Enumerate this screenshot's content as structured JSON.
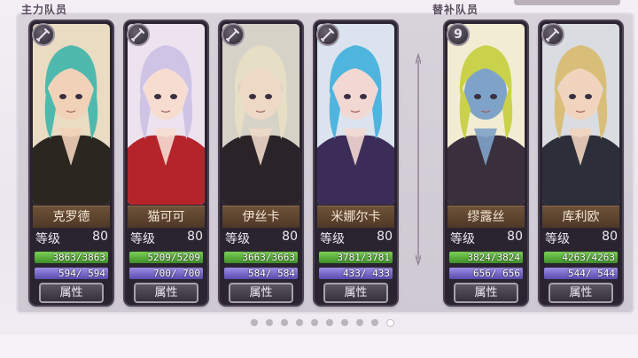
{
  "sections": {
    "main_label": "主力队员",
    "reserve_label": "替补队员"
  },
  "level_label": "等级",
  "attr_label": "属性",
  "cards": [
    {
      "name": "克罗德",
      "level": "80",
      "hp": "3863/3863",
      "mp": "594/ 594",
      "badge": "",
      "hair": "#4fb9ad",
      "skin": "#f1d2b8",
      "bg": "#e9dcc3",
      "outfit": "#2b2620"
    },
    {
      "name": "猫可可",
      "level": "80",
      "hp": "5209/5209",
      "mp": "700/ 700",
      "badge": "",
      "hair": "#cfc4e6",
      "skin": "#f6ddd0",
      "bg": "#ede3ee",
      "outfit": "#b5242b"
    },
    {
      "name": "伊丝卡",
      "level": "80",
      "hp": "3663/3663",
      "mp": "584/ 584",
      "badge": "",
      "hair": "#e7dec6",
      "skin": "#eed8c6",
      "bg": "#d6d2c8",
      "outfit": "#2a2428"
    },
    {
      "name": "米娜尔卡",
      "level": "80",
      "hp": "3781/3781",
      "mp": "433/ 433",
      "badge": "",
      "hair": "#4fb5de",
      "skin": "#f2d8d2",
      "bg": "#dbe4ee",
      "outfit": "#3c2c58"
    },
    {
      "name": "缪露丝",
      "level": "80",
      "hp": "3824/3824",
      "mp": "656/ 656",
      "badge": "9",
      "hair": "#c9d24a",
      "skin": "#7fa3c8",
      "bg": "#f2ecd3",
      "outfit": "#3a2f3c"
    },
    {
      "name": "库利欧",
      "level": "80",
      "hp": "4263/4263",
      "mp": "544/ 544",
      "badge": "",
      "hair": "#d9be7a",
      "skin": "#f1d4bd",
      "bg": "#d9dce0",
      "outfit": "#2c2e3a"
    }
  ],
  "pager": {
    "count": 10,
    "active": 9
  }
}
